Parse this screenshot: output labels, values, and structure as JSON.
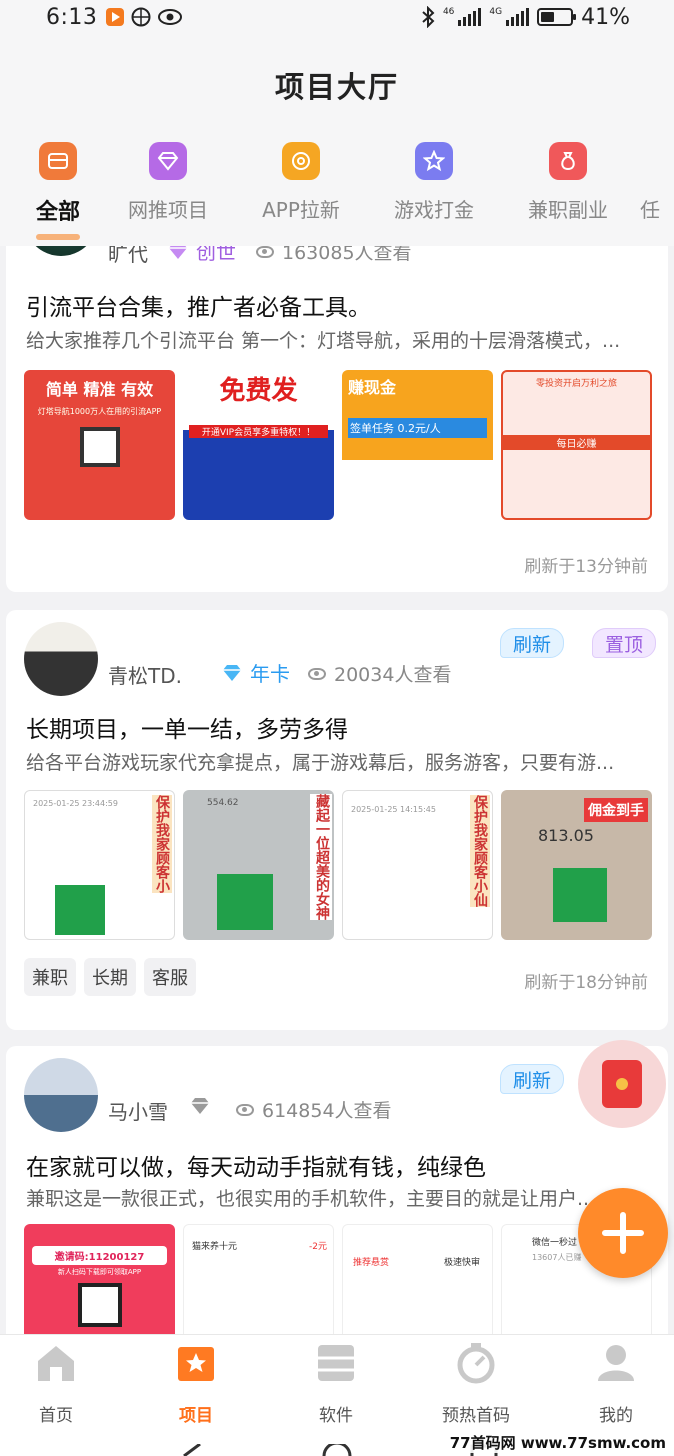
{
  "status_bar": {
    "time": "6:13",
    "battery": "41%",
    "net1": "46",
    "net2": "4G"
  },
  "header": {
    "title": "项目大厅",
    "categories": [
      {
        "label": "全部",
        "icon": "all-icon",
        "color": "#f07a3a"
      },
      {
        "label": "网推项目",
        "icon": "diamond-icon",
        "color": "#b56ae6"
      },
      {
        "label": "APP拉新",
        "icon": "coin-icon",
        "color": "#f5a623"
      },
      {
        "label": "游戏打金",
        "icon": "star-icon",
        "color": "#7b7cf0"
      },
      {
        "label": "兼职副业",
        "icon": "money-bag-icon",
        "color": "#f0585a"
      },
      {
        "label": "任"
      }
    ]
  },
  "posts": [
    {
      "username": "旷代",
      "level": "创世",
      "views": "163085人查看",
      "title": "引流平台合集，推广者必备工具。",
      "desc": "给大家推荐几个引流平台 第一个：灯塔导航，采用的十层滑落模式，...",
      "images": [
        {
          "headline": "简单 精准 有效",
          "sub": "灯塔导航1000万人在用的引流APP"
        },
        {
          "headline": "免费发",
          "sub": "开通VIP会员享多重特权！！"
        },
        {
          "headline": "赚现金",
          "sub": "签单任务 0.2元/人"
        },
        {
          "headline": "零投资开启万利之旅",
          "sub": "每日必赚"
        }
      ],
      "refreshed": "刷新于13分钟前"
    },
    {
      "username": "青松TD.",
      "level": "年卡",
      "views": "20034人查看",
      "title": "长期项目，一单一结，多劳多得",
      "desc": "给各平台游戏玩家代充拿提点，属于游戏幕后，服务游客，只要有游...",
      "images": [
        {
          "headline": "保护我家顾客小",
          "sub": "2025-01-25 23:44:59"
        },
        {
          "headline": "藏起一位超美的女神",
          "sub": "554.62"
        },
        {
          "headline": "保护我家顾客小仙",
          "sub": "2025-01-25 14:15:45"
        },
        {
          "headline": "佣金到手",
          "sub": "813.05"
        }
      ],
      "tags": [
        "兼职",
        "长期",
        "客服"
      ],
      "refreshed": "刷新于18分钟前",
      "pills": [
        "刷新",
        "置顶"
      ]
    },
    {
      "username": "马小雪",
      "views": "614854人查看",
      "title": "在家就可以做，每天动动手指就有钱，纯绿色",
      "desc": "兼职这是一款很正式，也很实用的手机软件，主要目的就是让用户...",
      "images": [
        {
          "headline": "邀请码:11200127",
          "sub": "新人扫码下载即可领取APP"
        },
        {
          "headline": "猫来养十元",
          "sub": "-2元"
        },
        {
          "headline": "推荐悬赏",
          "sub": "极速快审"
        },
        {
          "headline": "微信一秒过",
          "sub": "13607人已赚"
        }
      ],
      "pills": [
        "刷新"
      ]
    }
  ],
  "tabbar": [
    {
      "label": "首页",
      "icon": "home-icon"
    },
    {
      "label": "项目",
      "icon": "project-icon"
    },
    {
      "label": "软件",
      "icon": "software-icon"
    },
    {
      "label": "预热首码",
      "icon": "timer-icon"
    },
    {
      "label": "我的",
      "icon": "profile-icon"
    }
  ],
  "watermark": "77首码网 www.77smw.com",
  "colors": {
    "accent": "#ff6f1a",
    "blue_badge": "#1f8ee8",
    "purple_badge": "#9b5fe0"
  }
}
